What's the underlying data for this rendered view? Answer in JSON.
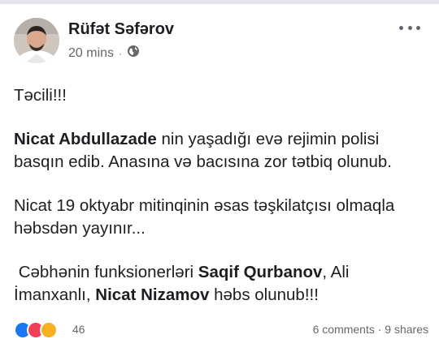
{
  "post": {
    "author": "Rüfət Səfərov",
    "time": "20 mins",
    "separator": "·",
    "para1": "Təcili!!!",
    "para2_bold": "Nicat Abdullazade",
    "para2_rest": " nin yaşadığı evə rejimin polisi basqın edib. Anasına və bacısına zor tətbiq olunub.",
    "para3": "Nicat 19 oktyabr mitinqinin əsas təşkilatçısı olmaqla həbsdən yayınır...",
    "para4_a": " Cəbhənin funksionerləri ",
    "para4_b1": "Saqif Qurbanov",
    "para4_c": ", Ali İmanxanlı, ",
    "para4_b2": "Nicat Nizamov",
    "para4_d": " həbs olunub!!!"
  },
  "footer": {
    "reaction_count": "46",
    "comments_shares": "6 comments · 9 shares"
  },
  "colors": {
    "text": "#1c1e21",
    "meta": "#65676b",
    "like": "#1877f2",
    "love": "#f33e58",
    "haha": "#f7b125"
  },
  "icons": {
    "privacy": "globe-icon",
    "menu": "more-options-icon"
  }
}
